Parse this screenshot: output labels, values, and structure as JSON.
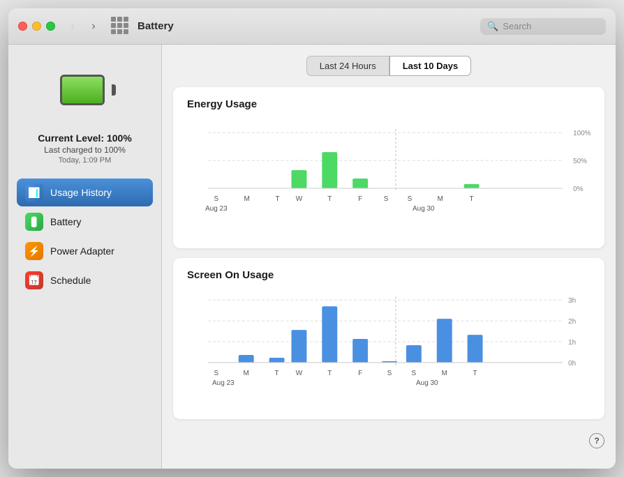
{
  "window": {
    "title": "Battery"
  },
  "titlebar": {
    "search_placeholder": "Search",
    "grid_icon_label": "App Grid"
  },
  "sidebar": {
    "battery_level_label": "Current Level: 100%",
    "battery_charged_label": "Last charged to 100%",
    "battery_time_label": "Today, 1:09 PM",
    "nav_items": [
      {
        "id": "usage-history",
        "label": "Usage History",
        "icon": "📊",
        "icon_class": "icon-usage",
        "active": true
      },
      {
        "id": "battery",
        "label": "Battery",
        "icon": "🔋",
        "icon_class": "icon-battery",
        "active": false
      },
      {
        "id": "power-adapter",
        "label": "Power Adapter",
        "icon": "⚡",
        "icon_class": "icon-power",
        "active": false
      },
      {
        "id": "schedule",
        "label": "Schedule",
        "icon": "📅",
        "icon_class": "icon-schedule",
        "active": false
      }
    ]
  },
  "tabs": [
    {
      "id": "last-24h",
      "label": "Last 24 Hours",
      "active": false
    },
    {
      "id": "last-10d",
      "label": "Last 10 Days",
      "active": true
    }
  ],
  "energy_chart": {
    "title": "Energy Usage",
    "y_labels": [
      "100%",
      "50%",
      "0%"
    ],
    "x_labels_week1": [
      "S",
      "M",
      "T",
      "W",
      "T",
      "F",
      "S"
    ],
    "x_labels_week2": [
      "S",
      "M",
      "T"
    ],
    "date_label1": "Aug 23",
    "date_label2": "Aug 30",
    "bars": [
      {
        "day": "S",
        "week": 1,
        "height_pct": 0
      },
      {
        "day": "M",
        "week": 1,
        "height_pct": 0
      },
      {
        "day": "T",
        "week": 1,
        "height_pct": 0
      },
      {
        "day": "W",
        "week": 1,
        "height_pct": 32
      },
      {
        "day": "T",
        "week": 1,
        "height_pct": 65
      },
      {
        "day": "F",
        "week": 1,
        "height_pct": 18
      },
      {
        "day": "S",
        "week": 1,
        "height_pct": 0
      },
      {
        "day": "S",
        "week": 2,
        "height_pct": 0
      },
      {
        "day": "M",
        "week": 2,
        "height_pct": 8
      },
      {
        "day": "T",
        "week": 2,
        "height_pct": 0
      }
    ]
  },
  "screen_chart": {
    "title": "Screen On Usage",
    "y_labels": [
      "3h",
      "2h",
      "1h",
      "0h"
    ],
    "date_label1": "Aug 23",
    "date_label2": "Aug 30",
    "bars": [
      {
        "day": "S",
        "height_pct": 0
      },
      {
        "day": "M",
        "height_pct": 12
      },
      {
        "day": "T",
        "height_pct": 8
      },
      {
        "day": "W",
        "height_pct": 52
      },
      {
        "day": "T",
        "height_pct": 90
      },
      {
        "day": "F",
        "height_pct": 38
      },
      {
        "day": "S",
        "height_pct": 2
      },
      {
        "day": "S",
        "height_pct": 28
      },
      {
        "day": "M",
        "height_pct": 70
      },
      {
        "day": "T",
        "height_pct": 45
      }
    ]
  },
  "help_button_label": "?"
}
